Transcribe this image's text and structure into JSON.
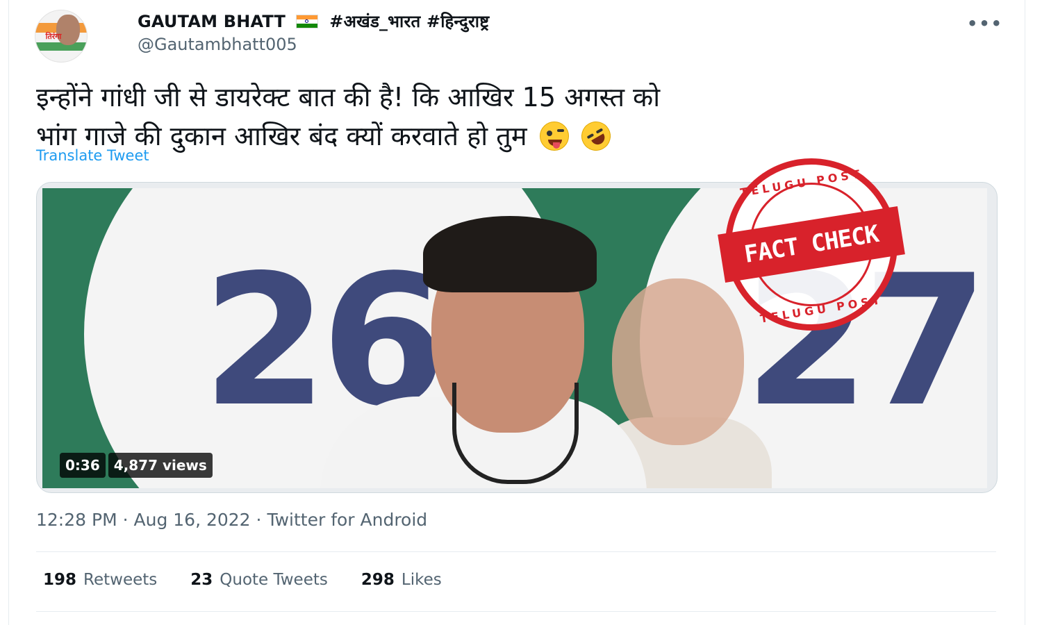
{
  "author": {
    "display_name": "GAUTAM BHATT",
    "hashtags": "#अखंड_भारत #हिन्दुराष्ट्र",
    "handle": "@Gautambhatt005",
    "avatar_text": "तिरंगा"
  },
  "tweet": {
    "text_line1": "इन्होंने गांधी जी से डायरेक्ट बात की है! कि आखिर 15 अगस्त को",
    "text_line2": "भांग गाजे की दुकान आखिर बंद क्यों करवाते हो तुम",
    "emojis": [
      "winking-face-with-tongue",
      "rolling-on-floor-laughing"
    ],
    "translate_label": "Translate Tweet"
  },
  "video": {
    "duration": "0:36",
    "views": "4,877 views",
    "background_text": "2627"
  },
  "stamp": {
    "top_text": "TELUGU POST",
    "banner_text": "FACT CHECK",
    "bottom_text": "TELUGU POST",
    "color": "#d8222b"
  },
  "meta": {
    "time": "12:28 PM",
    "date": "Aug 16, 2022",
    "source": "Twitter for Android",
    "separator": "·"
  },
  "stats": {
    "retweets_count": "198",
    "retweets_label": "Retweets",
    "quotes_count": "23",
    "quotes_label": "Quote Tweets",
    "likes_count": "298",
    "likes_label": "Likes"
  },
  "colors": {
    "link": "#1d9bf0",
    "muted": "#536471",
    "text": "#0f1419"
  }
}
